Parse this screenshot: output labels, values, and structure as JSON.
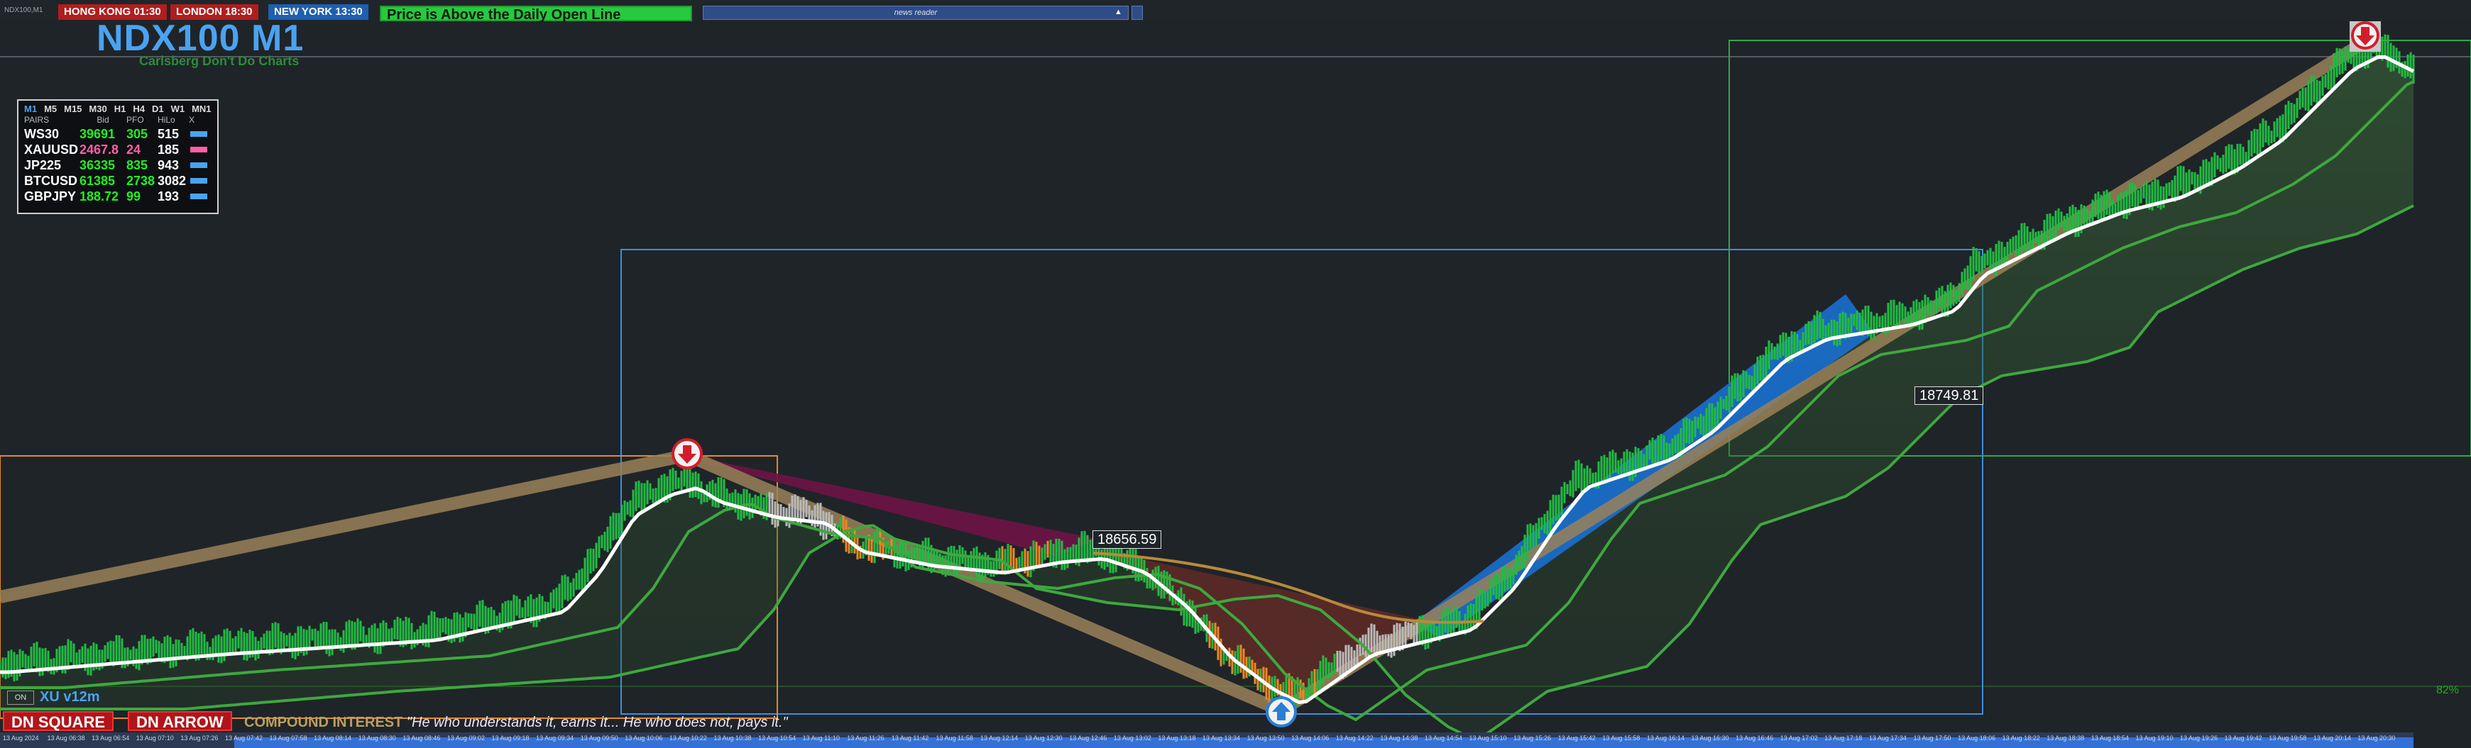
{
  "symbol_small": "NDX100,M1",
  "sessions": [
    {
      "label": "HONG KONG 01:30",
      "color": "#b01e1e"
    },
    {
      "label": "LONDON 18:30",
      "color": "#b01e1e"
    },
    {
      "label": "NEW YORK 13:30",
      "color": "#1e5fb0"
    }
  ],
  "status_message": "Price is Above the Daily Open Line",
  "news_reader": "news reader",
  "title": "NDX100 M1",
  "subtitle": "Carlsberg Don't Do Charts",
  "timeframes": [
    "M1",
    "M5",
    "M15",
    "M30",
    "H1",
    "H4",
    "D1",
    "W1",
    "MN1"
  ],
  "table_headers": {
    "pairs": "PAIRS",
    "bid": "Bid",
    "pfo": "PFO",
    "hilo": "HiLo",
    "x": "X"
  },
  "pairs": [
    {
      "name": "WS30",
      "bid": "39691",
      "pfo": "305",
      "hilo": "515",
      "bid_color": "#22ee22",
      "pfo_color": "#22ee22",
      "x_color": "#4aa3f0"
    },
    {
      "name": "XAUUSD",
      "bid": "2467.8",
      "pfo": "24",
      "hilo": "185",
      "bid_color": "#ff5fa8",
      "pfo_color": "#ff5fa8",
      "x_color": "#ff5fa8"
    },
    {
      "name": "JP225",
      "bid": "36335",
      "pfo": "835",
      "hilo": "943",
      "bid_color": "#22ee22",
      "pfo_color": "#22ee22",
      "x_color": "#4aa3f0"
    },
    {
      "name": "BTCUSD",
      "bid": "61385",
      "pfo": "2738",
      "hilo": "3082",
      "bid_color": "#22ee22",
      "pfo_color": "#22ee22",
      "x_color": "#4aa3f0"
    },
    {
      "name": "GBPJPY",
      "bid": "188.72",
      "pfo": "99",
      "hilo": "193",
      "bid_color": "#22ee22",
      "pfo_color": "#22ee22",
      "x_color": "#4aa3f0"
    }
  ],
  "price_labels": [
    "18656.59",
    "18749.81"
  ],
  "on_label": "ON",
  "version": "XU v12m",
  "buttons": {
    "dn_square": "DN SQUARE",
    "dn_arrow": "DN ARROW"
  },
  "compound_label": "COMPOUND INTEREST",
  "quote": "\"He who understands it, earns it... He who does not, pays it.\"",
  "percent_label": "82%",
  "time_ticks": [
    "13 Aug 2024",
    "13 Aug 06:38",
    "13 Aug 06:54",
    "13 Aug 07:10",
    "13 Aug 07:26",
    "13 Aug 07:42",
    "13 Aug 07:58",
    "13 Aug 08:14",
    "13 Aug 08:30",
    "13 Aug 08:46",
    "13 Aug 09:02",
    "13 Aug 09:18",
    "13 Aug 09:34",
    "13 Aug 09:50",
    "13 Aug 10:06",
    "13 Aug 10:22",
    "13 Aug 10:38",
    "13 Aug 10:54",
    "13 Aug 11:10",
    "13 Aug 11:26",
    "13 Aug 11:42",
    "13 Aug 11:58",
    "13 Aug 12:14",
    "13 Aug 12:30",
    "13 Aug 12:46",
    "13 Aug 13:02",
    "13 Aug 13:18",
    "13 Aug 13:34",
    "13 Aug 13:50",
    "13 Aug 14:06",
    "13 Aug 14:22",
    "13 Aug 14:38",
    "13 Aug 14:54",
    "13 Aug 15:10",
    "13 Aug 15:26",
    "13 Aug 15:42",
    "13 Aug 15:58",
    "13 Aug 16:14",
    "13 Aug 16:30",
    "13 Aug 16:46",
    "13 Aug 17:02",
    "13 Aug 17:18",
    "13 Aug 17:34",
    "13 Aug 17:50",
    "13 Aug 18:06",
    "13 Aug 18:22",
    "13 Aug 18:38",
    "13 Aug 18:54",
    "13 Aug 19:10",
    "13 Aug 19:26",
    "13 Aug 19:42",
    "13 Aug 19:58",
    "13 Aug 20:14",
    "13 Aug 20:30"
  ],
  "colors": {
    "bull": "#22bb44",
    "bear": "#ee8820",
    "neutral": "#bbbbbb",
    "ma_fast": "#ffffff",
    "ma_slow": "#3ea83e"
  }
}
